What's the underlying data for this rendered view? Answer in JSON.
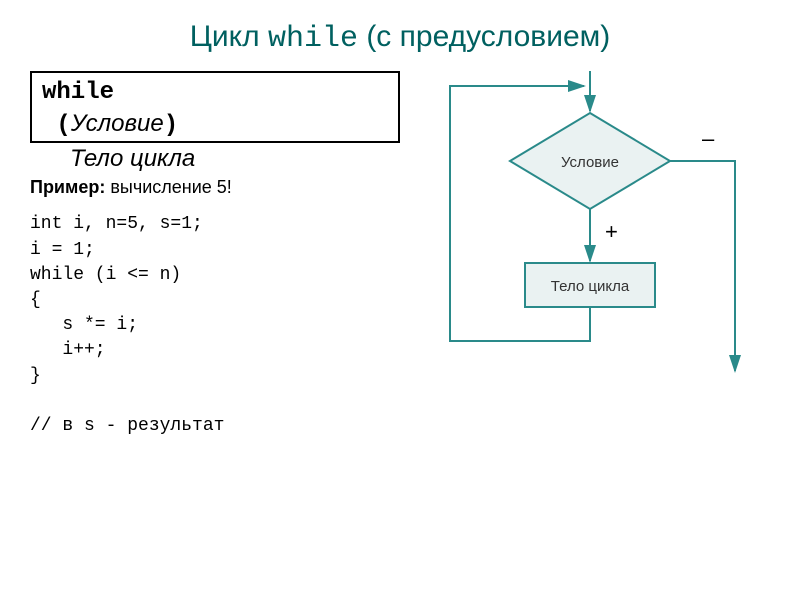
{
  "title_prefix": "Цикл ",
  "title_keyword": "while",
  "title_suffix": " (с предусловием)",
  "syntax": {
    "keyword": "while",
    "paren_open": "(",
    "condition": "Условие",
    "paren_close": ")",
    "body": "Тело цикла"
  },
  "example_label_bold": "Пример:",
  "example_label_rest": " вычисление 5!",
  "code_text": "int i, n=5, s=1;\ni = 1;\nwhile (i <= n)\n{\n   s *= i;\n   i++;\n}\n\n// в s - результат",
  "flowchart": {
    "decision": "Условие",
    "process": "Тело цикла",
    "true_branch": "+",
    "false_branch": "–"
  }
}
